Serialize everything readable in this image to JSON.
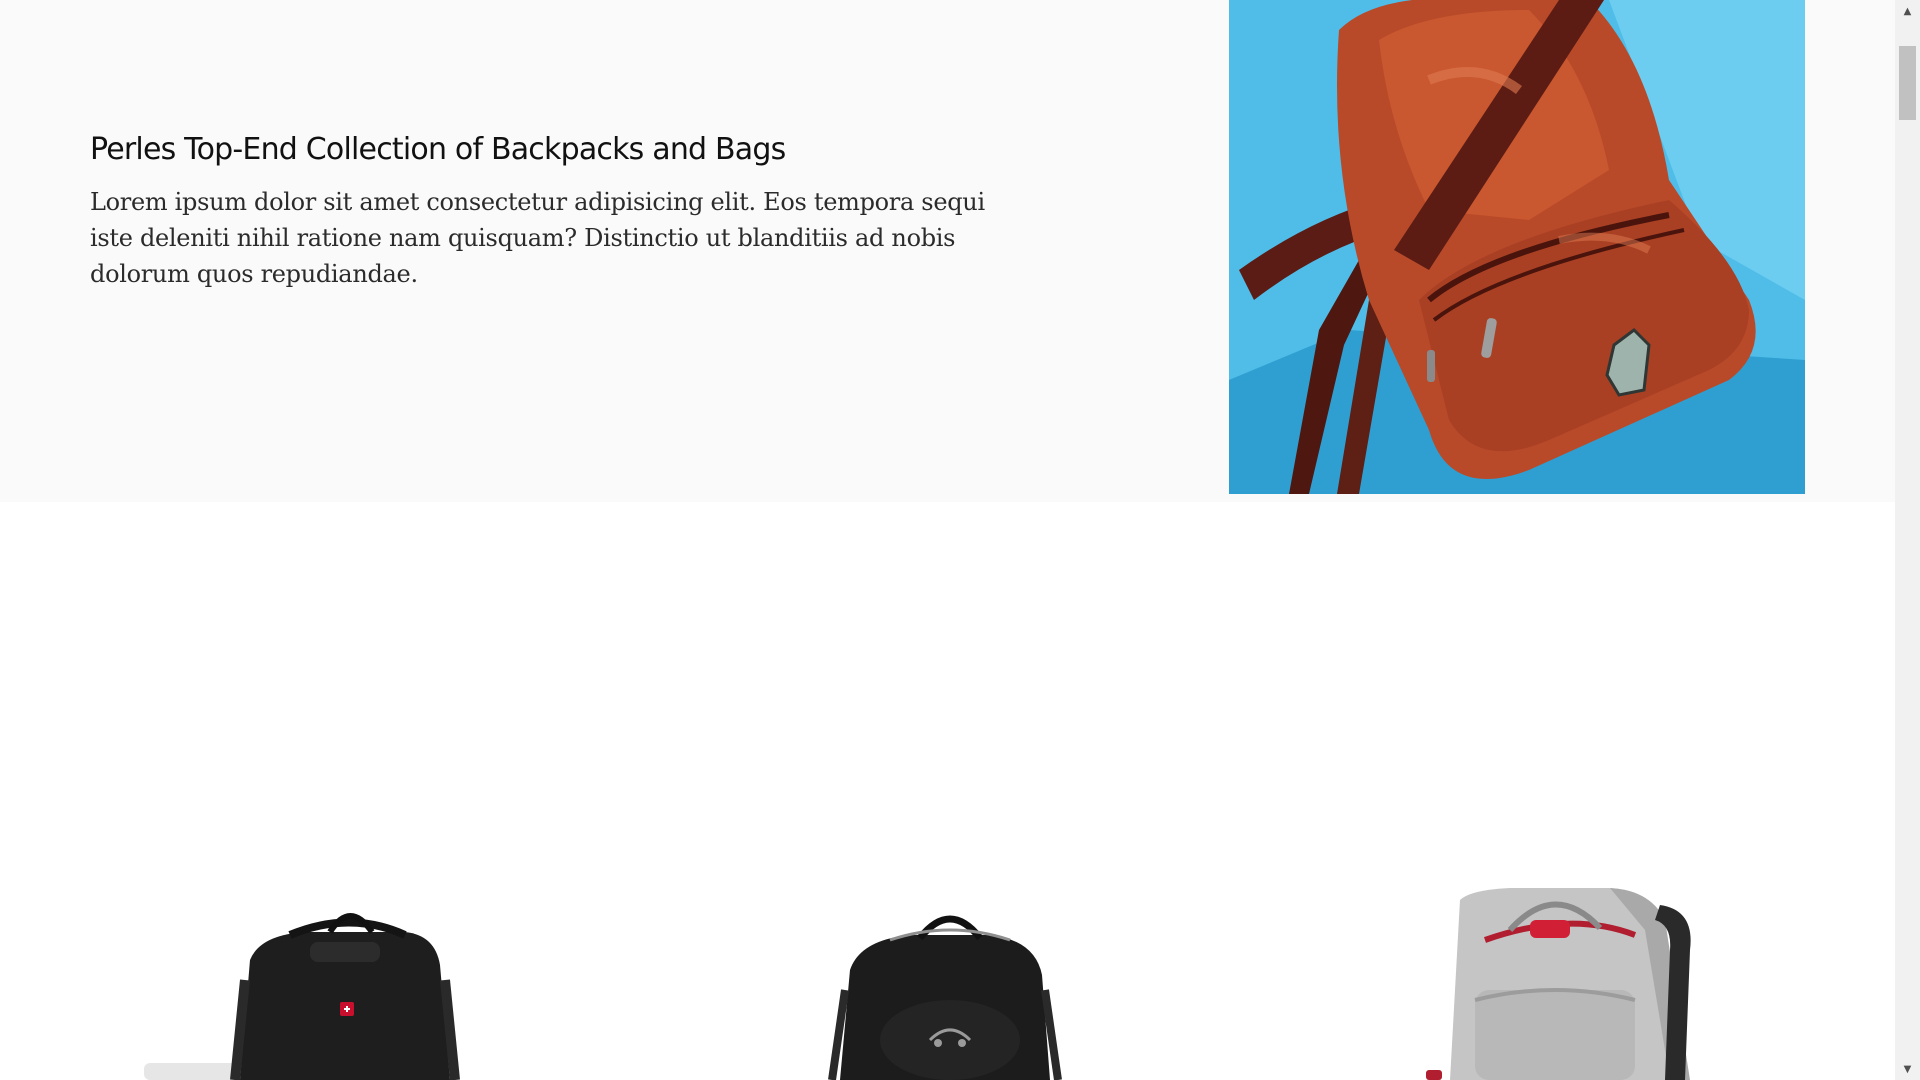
{
  "hero": {
    "title": "Perles Top-End Collection of Backpacks and Bags",
    "description": "Lorem ipsum dolor sit amet consectetur adipisicing elit. Eos tempora sequi iste deleniti nihil ratione nam quisquam? Distinctio ut blanditiis ad nobis dolorum quos repudiandae.",
    "image_label": "red leather backpack on blue background"
  },
  "products": [
    {
      "name": "black backpack with laptop",
      "color": "#1a1a1a"
    },
    {
      "name": "black backpack",
      "color": "#1c1c1c"
    },
    {
      "name": "grey backpack",
      "color": "#a9a9a9"
    }
  ],
  "scrollbar": {
    "up_icon": "arrow-up-icon",
    "down_icon": "arrow-down-icon"
  },
  "colors": {
    "hero_background": "#fafafa",
    "page_background": "#ffffff",
    "hero_image_background": "#47b6e3",
    "backpack_leather": "#b84a2a"
  }
}
